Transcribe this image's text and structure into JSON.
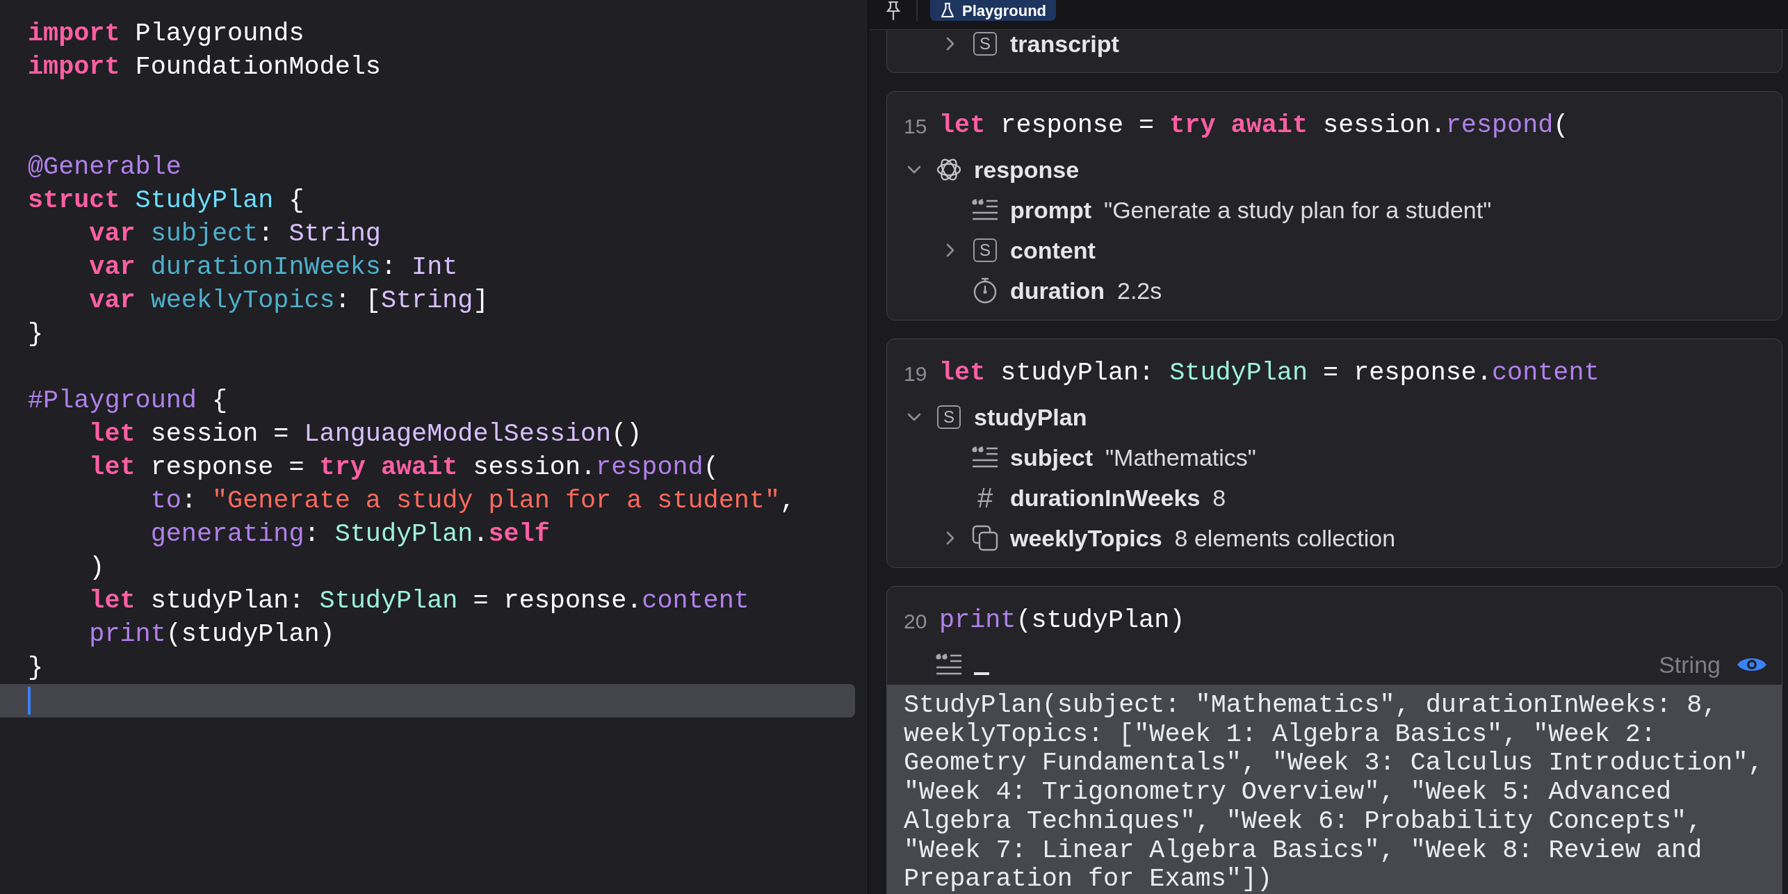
{
  "editor": {
    "lines": [
      {
        "current": false,
        "tokens": [
          {
            "kind": "kw",
            "text": "import"
          },
          {
            "kind": "plain",
            "text": " Playgrounds"
          }
        ]
      },
      {
        "current": false,
        "tokens": [
          {
            "kind": "kw",
            "text": "import"
          },
          {
            "kind": "plain",
            "text": " FoundationModels"
          }
        ]
      },
      {
        "current": false
      },
      {
        "current": false
      },
      {
        "current": false,
        "tokens": [
          {
            "kind": "attr",
            "text": "@Generable"
          }
        ]
      },
      {
        "current": false,
        "tokens": [
          {
            "kind": "kw",
            "text": "struct"
          },
          {
            "kind": "decl",
            "text": " StudyPlan"
          },
          {
            "kind": "plain",
            "text": " {"
          }
        ]
      },
      {
        "current": false,
        "tokens": [
          {
            "kind": "kw",
            "text": "    var"
          },
          {
            "kind": "member",
            "text": " subject"
          },
          {
            "kind": "plain",
            "text": ":"
          },
          {
            "kind": "systype",
            "text": " String"
          }
        ]
      },
      {
        "current": false,
        "tokens": [
          {
            "kind": "kw",
            "text": "    var"
          },
          {
            "kind": "member",
            "text": " durationInWeeks"
          },
          {
            "kind": "plain",
            "text": ":"
          },
          {
            "kind": "systype",
            "text": " Int"
          }
        ]
      },
      {
        "current": false,
        "tokens": [
          {
            "kind": "kw",
            "text": "    var"
          },
          {
            "kind": "member",
            "text": " weeklyTopics"
          },
          {
            "kind": "plain",
            "text": ": ["
          },
          {
            "kind": "systype",
            "text": "String"
          },
          {
            "kind": "plain",
            "text": "]"
          }
        ]
      },
      {
        "current": false,
        "tokens": [
          {
            "kind": "plain",
            "text": "}"
          }
        ]
      },
      {
        "current": false
      },
      {
        "current": false,
        "tokens": [
          {
            "kind": "attr",
            "text": "#Playground"
          },
          {
            "kind": "plain",
            "text": " {"
          }
        ]
      },
      {
        "current": false,
        "tokens": [
          {
            "kind": "kw",
            "text": "    let"
          },
          {
            "kind": "plain",
            "text": " session ="
          },
          {
            "kind": "systype",
            "text": " LanguageModelSession"
          },
          {
            "kind": "plain",
            "text": "()"
          }
        ]
      },
      {
        "current": false,
        "tokens": [
          {
            "kind": "kw",
            "text": "    let"
          },
          {
            "kind": "plain",
            "text": " response ="
          },
          {
            "kind": "kw",
            "text": " try"
          },
          {
            "kind": "kw",
            "text": " await"
          },
          {
            "kind": "plain",
            "text": " session."
          },
          {
            "kind": "attr",
            "text": "respond"
          },
          {
            "kind": "plain",
            "text": "("
          }
        ]
      },
      {
        "current": false,
        "tokens": [
          {
            "kind": "attr",
            "text": "        to"
          },
          {
            "kind": "plain",
            "text": ":"
          },
          {
            "kind": "str",
            "text": " \"Generate a study plan for a student\""
          },
          {
            "kind": "plain",
            "text": ","
          }
        ]
      },
      {
        "current": false,
        "tokens": [
          {
            "kind": "attr",
            "text": "        generating"
          },
          {
            "kind": "plain",
            "text": ":"
          },
          {
            "kind": "type",
            "text": " StudyPlan"
          },
          {
            "kind": "plain",
            "text": "."
          },
          {
            "kind": "kw",
            "text": "self"
          }
        ]
      },
      {
        "current": false,
        "tokens": [
          {
            "kind": "plain",
            "text": "    )"
          }
        ]
      },
      {
        "current": false,
        "tokens": [
          {
            "kind": "kw",
            "text": "    let"
          },
          {
            "kind": "plain",
            "text": " studyPlan:"
          },
          {
            "kind": "type",
            "text": " StudyPlan"
          },
          {
            "kind": "plain",
            "text": " = response."
          },
          {
            "kind": "attr",
            "text": "content"
          }
        ]
      },
      {
        "current": false,
        "tokens": [
          {
            "kind": "attr",
            "text": "    print"
          },
          {
            "kind": "plain",
            "text": "(studyPlan)"
          }
        ]
      },
      {
        "current": false,
        "tokens": [
          {
            "kind": "plain",
            "text": "}"
          }
        ]
      },
      {
        "current": true
      }
    ]
  },
  "results": {
    "tabs": [
      {
        "label": "Playground",
        "selected": true
      }
    ],
    "cards": [
      {
        "continued": true,
        "tree": [
          {
            "kind": "struct",
            "badge": "S",
            "name": "transcript",
            "expanded": false
          }
        ]
      },
      {
        "line": "15",
        "code": [
          {
            "kind": "kw",
            "text": "let"
          },
          {
            "kind": "plain",
            "text": " response ="
          },
          {
            "kind": "kw",
            "text": " try"
          },
          {
            "kind": "kw",
            "text": " await"
          },
          {
            "kind": "plain",
            "text": " session."
          },
          {
            "kind": "attr",
            "text": "respond"
          },
          {
            "kind": "plain",
            "text": "("
          }
        ],
        "tree": [
          {
            "kind": "model",
            "name": "response",
            "expanded": true,
            "children": [
              {
                "kind": "string",
                "name": "prompt",
                "value": "\"Generate a study plan for a student\""
              },
              {
                "kind": "struct",
                "badge": "S",
                "name": "content",
                "expanded": false
              },
              {
                "kind": "timer",
                "name": "duration",
                "value": "2.2s"
              }
            ]
          }
        ]
      },
      {
        "line": "19",
        "code": [
          {
            "kind": "kw",
            "text": "let"
          },
          {
            "kind": "plain",
            "text": " studyPlan:"
          },
          {
            "kind": "type",
            "text": " StudyPlan"
          },
          {
            "kind": "plain",
            "text": " = response."
          },
          {
            "kind": "attr",
            "text": "content"
          }
        ],
        "tree": [
          {
            "kind": "struct",
            "badge": "S",
            "name": "studyPlan",
            "expanded": true,
            "children": [
              {
                "kind": "string",
                "name": "subject",
                "value": "\"Mathematics\""
              },
              {
                "kind": "number",
                "badge": "#",
                "name": "durationInWeeks",
                "value": "8"
              },
              {
                "kind": "collection",
                "name": "weeklyTopics",
                "value": "8 elements collection",
                "expanded": false
              }
            ]
          }
        ]
      },
      {
        "line": "20",
        "code": [
          {
            "kind": "attr",
            "text": "print"
          },
          {
            "kind": "plain",
            "text": "(studyPlan)"
          }
        ],
        "result": {
          "kind": "string",
          "type": "String",
          "preview_on": true,
          "output": [
            "StudyPlan(subject: \"Mathematics\", durationInWeeks: 8,",
            "weeklyTopics: [\"Week 1: Algebra Basics\", \"Week 2:",
            "Geometry Fundamentals\", \"Week 3: Calculus Introduction\",",
            "\"Week 4: Trigonometry Overview\", \"Week 5: Advanced",
            "Algebra Techniques\", \"Week 6: Probability Concepts\",",
            "\"Week 7: Linear Algebra Basics\", \"Week 8: Review and",
            "Preparation for Exams\"])"
          ]
        }
      }
    ]
  }
}
